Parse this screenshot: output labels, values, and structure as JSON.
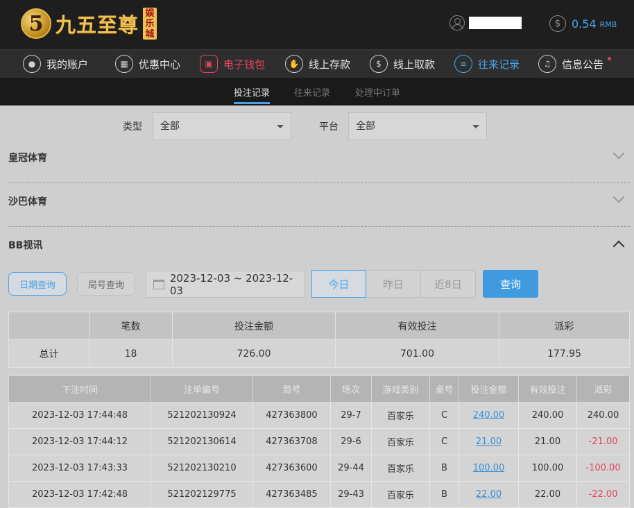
{
  "brand": {
    "logo_digit": "5",
    "name": "九五至尊",
    "badge": "娱乐城"
  },
  "header": {
    "balance": "0.54",
    "currency": "RMB"
  },
  "nav": [
    {
      "label": "我的账户",
      "icon": "user-icon"
    },
    {
      "label": "优惠中心",
      "icon": "gift-icon"
    },
    {
      "label": "电子钱包",
      "icon": "wallet-icon"
    },
    {
      "label": "线上存款",
      "icon": "deposit-icon"
    },
    {
      "label": "线上取款",
      "icon": "withdraw-icon"
    },
    {
      "label": "往来记录",
      "icon": "records-icon"
    },
    {
      "label": "信息公告",
      "icon": "bell-icon"
    }
  ],
  "subtabs": [
    "投注记录",
    "往来记录",
    "处理中订单"
  ],
  "filters": {
    "type_label": "类型",
    "type_value": "全部",
    "platform_label": "平台",
    "platform_value": "全部"
  },
  "sections": [
    "皇冠体育",
    "沙巴体育",
    "BB视讯"
  ],
  "query": {
    "date_query": "日期查询",
    "round_query": "局号查询",
    "date_range": "2023-12-03 ~ 2023-12-03",
    "today": "今日",
    "yesterday": "昨日",
    "last8": "近8日",
    "search": "查询"
  },
  "summary": {
    "headers": [
      "",
      "笔数",
      "投注金额",
      "有效投注",
      "派彩"
    ],
    "row": [
      "总计",
      "18",
      "726.00",
      "701.00",
      "177.95"
    ]
  },
  "detail": {
    "headers": [
      "下注时间",
      "注单编号",
      "局号",
      "场次",
      "游戏类别",
      "桌号",
      "投注金额",
      "有效投注",
      "派彩"
    ],
    "rows": [
      [
        "2023-12-03 17:44:48",
        "521202130924",
        "427363800",
        "29-7",
        "百家乐",
        "C",
        "240.00",
        "240.00",
        "240.00"
      ],
      [
        "2023-12-03 17:44:12",
        "521202130614",
        "427363708",
        "29-6",
        "百家乐",
        "C",
        "21.00",
        "21.00",
        "-21.00"
      ],
      [
        "2023-12-03 17:43:33",
        "521202130210",
        "427363600",
        "29-44",
        "百家乐",
        "B",
        "100.00",
        "100.00",
        "-100.00"
      ],
      [
        "2023-12-03 17:42:48",
        "521202129775",
        "427363485",
        "29-43",
        "百家乐",
        "B",
        "22.00",
        "22.00",
        "-22.00"
      ]
    ]
  }
}
